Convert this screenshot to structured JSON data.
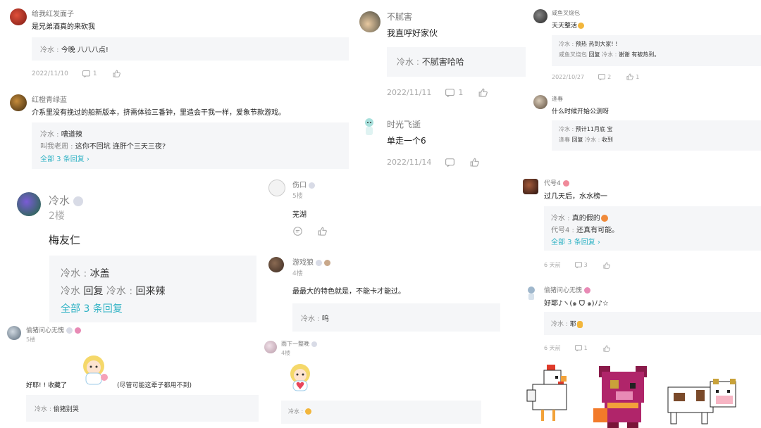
{
  "c1": {
    "user": "给我红发面子",
    "content": "是兄弟酒真的来砍我",
    "reply": {
      "name": "冷水",
      "text": "今晚 八八八点!"
    },
    "date": "2022/11/10",
    "comments": "1"
  },
  "c2": {
    "user": "红橙青绿蓝",
    "content": "介系里没有挽过的船新版本，挤需体验三番钟，里造会干我一样，爱象节款游戏。",
    "replies": [
      {
        "name": "冷水",
        "text": "嘈道辣"
      },
      {
        "name": "叫我老周",
        "text": "这你不回坑 连肝个三天三夜?"
      }
    ],
    "more": "全部 3 条回复 ›"
  },
  "c3": {
    "user": "冷水",
    "floor": "2楼",
    "content": "梅友仁",
    "reply1": {
      "name": "冷水",
      "text": "冰盖"
    },
    "reply2": {
      "name": "冷水",
      "verb": "回复",
      "target": "冷水",
      "text": "回来辣"
    },
    "more": "全部 3 条回复"
  },
  "c4": {
    "user": "偷猪问心无愧",
    "floor": "5楼",
    "content": "好耶! ! 收藏了",
    "content2": "(尽管可能这辈子都用不到)",
    "reply": {
      "name": "冷水",
      "text": "偷猪别哭"
    }
  },
  "c5": {
    "user": "不腻害",
    "content": "我直呼好家伙",
    "reply": {
      "name": "冷水",
      "text": "不腻害哈哈"
    },
    "date": "2022/11/11",
    "comments": "1"
  },
  "c6": {
    "user": "时光飞逝",
    "content": "单走一个6",
    "date": "2022/11/14"
  },
  "c7": {
    "user": "伤口",
    "floor": "5楼",
    "content": "芜湖"
  },
  "c8": {
    "user": "游戏狼",
    "floor": "4楼",
    "content": "最最大的特色就是，不能卡才能过。",
    "reply": {
      "name": "冷水",
      "text": "呜"
    }
  },
  "c9": {
    "user": "雨下一整晚",
    "floor": "4楼",
    "reply": {
      "name": "冷水",
      "text": ""
    }
  },
  "c10": {
    "user": "咸鱼叉烧包",
    "content": "天天整活",
    "replies": [
      {
        "name": "冷水",
        "text": "预热 热到大家! !"
      },
      {
        "name": "咸鱼叉烧包",
        "verb": "回复",
        "target": "冷水",
        "text": "谢谢 有被热到。"
      }
    ],
    "date": "2022/10/27",
    "comments": "2",
    "likes": "1"
  },
  "c11": {
    "user": "逢春",
    "content": "什么时候开始公测呀",
    "replies": [
      {
        "name": "冷水",
        "text": "预计11月底 宝"
      },
      {
        "name": "逢春",
        "verb": "回复",
        "target": "冷水",
        "text": "收到"
      }
    ]
  },
  "c12": {
    "user": "代号4",
    "content": "过几天后，水水榜一",
    "replies": [
      {
        "name": "冷水",
        "text": "真的假的"
      },
      {
        "name": "代号4",
        "text": "还真有可能。"
      }
    ],
    "more": "全部 3 条回复 ›",
    "date": "6 天前",
    "comments": "3"
  },
  "c13": {
    "user": "偷猪问心无愧",
    "content": "好耶♪ヽ(๑ ᗜ ๑)ﾉ♪☆",
    "reply": {
      "name": "冷水",
      "text": "耶"
    },
    "date": "6 天前",
    "comments": "1"
  },
  "colors": {
    "accent": "#2fb2c4",
    "reply_bg": "#f5f6f8",
    "muted": "#aaaaaa"
  }
}
